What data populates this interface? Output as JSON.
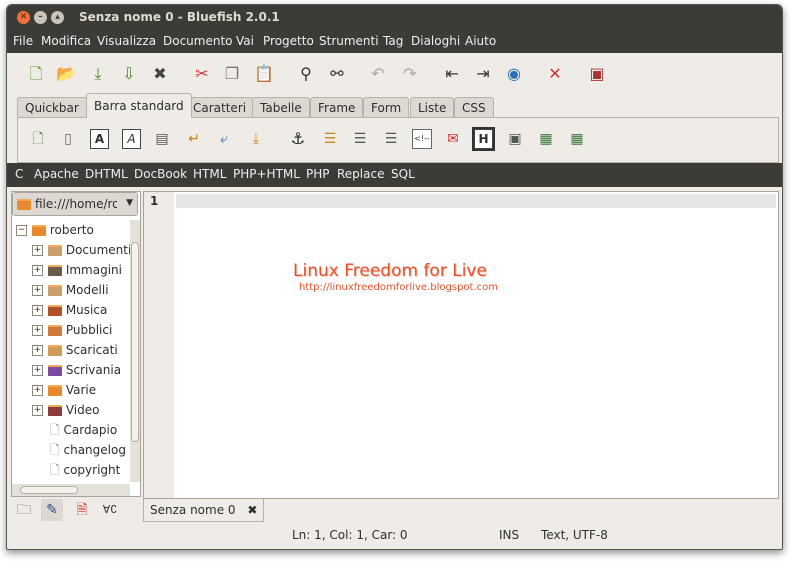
{
  "window": {
    "title": "Senza nome 0 - Bluefish 2.0.1"
  },
  "menu": [
    "File",
    "Modifica",
    "Visualizza",
    "Documento",
    "Vai",
    "Progetto",
    "Strumenti",
    "Tag",
    "Dialoghi",
    "Aiuto"
  ],
  "toolbar_icons": [
    "new-file-icon",
    "open-file-icon",
    "save-icon",
    "save-as-icon",
    "close-icon",
    "cut-icon",
    "copy-icon",
    "paste-icon",
    "find-icon",
    "replace-icon",
    "undo-icon",
    "redo-icon",
    "unindent-icon",
    "indent-icon",
    "preview-icon",
    "tools-icon",
    "fullscreen-icon"
  ],
  "tabs": [
    "Quickbar",
    "Barra standard",
    "Caratteri",
    "Tabelle",
    "Frame",
    "Form",
    "Liste",
    "CSS"
  ],
  "active_tab": "Barra standard",
  "html_toolbar_icons": [
    "quickstart-icon",
    "body-icon",
    "bold-icon",
    "italic-icon",
    "paragraph-icon",
    "break-icon",
    "break-clear-icon",
    "nbsp-icon",
    "anchor-icon",
    "align-left-icon",
    "align-center-icon",
    "align-right-icon",
    "comment-icon",
    "email-icon",
    "heading-icon",
    "image-icon",
    "thumbnail-icon",
    "multi-thumbnail-icon"
  ],
  "html_toolbar_glyphs": {
    "bold": "A",
    "italic": "A",
    "heading": "H",
    "comment": "<!--"
  },
  "languages": [
    "C",
    "Apache",
    "DHTML",
    "DocBook",
    "HTML",
    "PHP+HTML",
    "PHP",
    "Replace",
    "SQL"
  ],
  "file_browser": {
    "path": "file:///home/roberto",
    "root": "roberto",
    "folders": [
      "Documenti",
      "Immagini",
      "Modelli",
      "Musica",
      "Pubblici",
      "Scaricati",
      "Scrivania",
      "Varie",
      "Video"
    ],
    "files": [
      "Cardapio",
      "changelog",
      "copyright"
    ]
  },
  "editor": {
    "line_number": "1"
  },
  "watermark": {
    "title": "Linux Freedom for Live",
    "url": "http://linuxfreedomforlive.blogspot.com"
  },
  "document_tab": {
    "label": "Senza nome 0"
  },
  "status": {
    "position": "Ln: 1, Col: 1, Car: 0",
    "mode": "INS",
    "encoding": "Text, UTF-8"
  },
  "colors": {
    "titlebar": "#3c3b37",
    "accent_close": "#f0713d",
    "folder": "#e8892f",
    "watermark": "#e0532d"
  }
}
